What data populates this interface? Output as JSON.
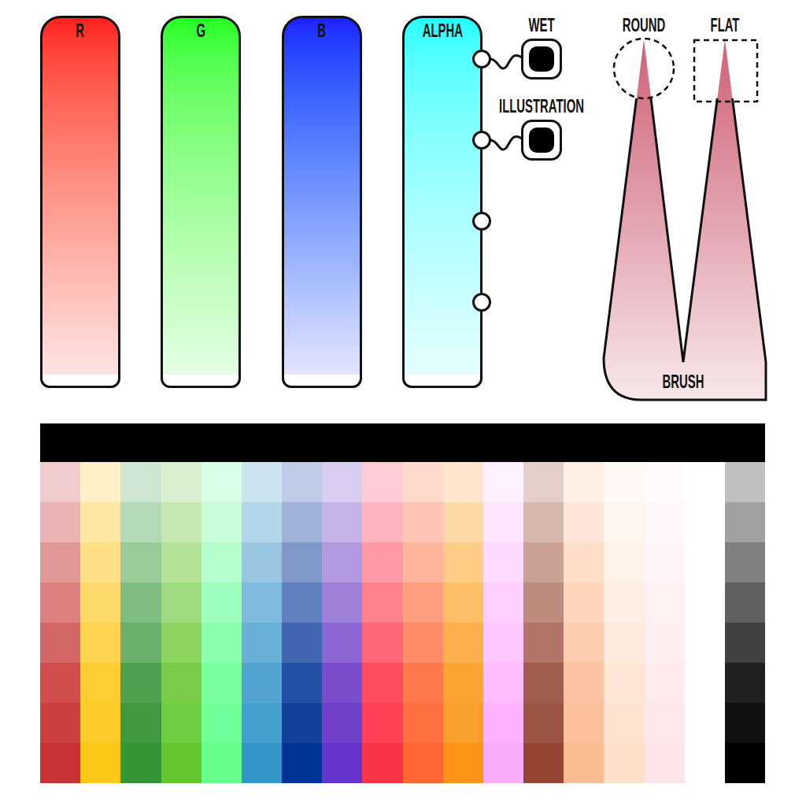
{
  "sliders": [
    {
      "label": "R",
      "color": "#ff1f1f",
      "ports": []
    },
    {
      "label": "G",
      "color": "#22ff22",
      "ports": []
    },
    {
      "label": "B",
      "color": "#2020ff",
      "ports": []
    },
    {
      "label": "ALPHA",
      "color": "#22ffff",
      "ports": [
        {
          "toggle_label": "WET",
          "connected": true,
          "on": true
        },
        {
          "toggle_label": "ILLUSTRATION",
          "connected": true,
          "on": true
        },
        {
          "toggle_label": "",
          "connected": false,
          "on": false
        },
        {
          "toggle_label": "",
          "connected": false,
          "on": false
        }
      ]
    }
  ],
  "brush": {
    "label": "BRUSH",
    "tips": [
      {
        "label": "ROUND",
        "kind": "round"
      },
      {
        "label": "FLAT",
        "kind": "flat"
      }
    ]
  },
  "palette": {
    "current_color": "#000000",
    "columns": [
      {
        "colors": [
          "#f0cccc",
          "#ebb3b3",
          "#e39898",
          "#dd8080",
          "#d46666",
          "#cf4d4d",
          "#cb3f3f",
          "#c83232"
        ]
      },
      {
        "colors": [
          "#fff0c8",
          "#ffe8a3",
          "#ffe088",
          "#fdd86b",
          "#fcd450",
          "#fdcd33",
          "#fdcc2a",
          "#fcc716"
        ]
      },
      {
        "colors": [
          "#cfe6d3",
          "#b3d9b6",
          "#99cc99",
          "#80bd80",
          "#6aaf6a",
          "#4fa14f",
          "#409840",
          "#339533"
        ]
      },
      {
        "colors": [
          "#d9f0d0",
          "#c8e8b3",
          "#b4e499",
          "#a0dc7f",
          "#8ed55f",
          "#7acc4a",
          "#6ece40",
          "#63c62e"
        ]
      },
      {
        "colors": [
          "#d9ffe6",
          "#c8ffda",
          "#b4ffcd",
          "#9effbf",
          "#8cffaf",
          "#7aff9d",
          "#70ff99",
          "#66ff8c"
        ]
      },
      {
        "colors": [
          "#cce3f0",
          "#b3d6e8",
          "#99c6e0",
          "#80bade",
          "#69b0d8",
          "#53a3d1",
          "#45a0d0",
          "#3296c9"
        ]
      },
      {
        "colors": [
          "#bfcbe6",
          "#9fb2da",
          "#7f98c8",
          "#6080bf",
          "#4066b0",
          "#2350a6",
          "#13409b",
          "#003396"
        ]
      },
      {
        "colors": [
          "#d8ccf0",
          "#c6b3e8",
          "#b39ae0",
          "#9f80d9",
          "#8c66d3",
          "#7a4dcc",
          "#7040c8",
          "#6633cc"
        ]
      },
      {
        "colors": [
          "#ffccd5",
          "#ffb3be",
          "#ff99a6",
          "#ff808e",
          "#ff6677",
          "#ff4d5f",
          "#ff4055",
          "#f93446"
        ]
      },
      {
        "colors": [
          "#ffd9cc",
          "#ffc4b3",
          "#ffb399",
          "#ff9f80",
          "#ff8c66",
          "#ff794d",
          "#ff6f40",
          "#ff6633"
        ]
      },
      {
        "colors": [
          "#ffe6cc",
          "#ffd9a6",
          "#ffcc88",
          "#ffbf66",
          "#fcb04d",
          "#fca433",
          "#f99f2a",
          "#fc9418"
        ]
      },
      {
        "colors": [
          "#fff0ff",
          "#ffe6ff",
          "#ffd9ff",
          "#ffd0ff",
          "#ffc6ff",
          "#ffbdff",
          "#ffb3ff",
          "#f9aef9"
        ]
      },
      {
        "colors": [
          "#e3cfc8",
          "#d6b8ad",
          "#c9a195",
          "#bd8b7d",
          "#b07566",
          "#a05c4d",
          "#9c5545",
          "#944433"
        ]
      },
      {
        "colors": [
          "#fff0e6",
          "#ffe6d9",
          "#ffddc8",
          "#ffd5bc",
          "#fccdb0",
          "#fdc3a0",
          "#fdc09c",
          "#fabb90"
        ]
      },
      {
        "colors": [
          "#fff9f3",
          "#fff6ef",
          "#fff3e9",
          "#ffeee3",
          "#ffeadd",
          "#ffe6d6",
          "#ffe3d0",
          "#ffe0cc"
        ]
      },
      {
        "colors": [
          "#fffafc",
          "#fff8fa",
          "#fff4f7",
          "#fff1f4",
          "#ffeef2",
          "#ffebef",
          "#ffe8ec",
          "#ffe5eb"
        ]
      },
      {
        "colors": [
          "#ffffff",
          "#ffffff",
          "#ffffff",
          "#ffffff",
          "#ffffff",
          "#ffffff",
          "#ffffff",
          "#ffffff"
        ]
      },
      {
        "colors": [
          "#c0c0c0",
          "#a0a0a0",
          "#808080",
          "#606060",
          "#404040",
          "#202020",
          "#101010",
          "#000000"
        ]
      }
    ]
  }
}
